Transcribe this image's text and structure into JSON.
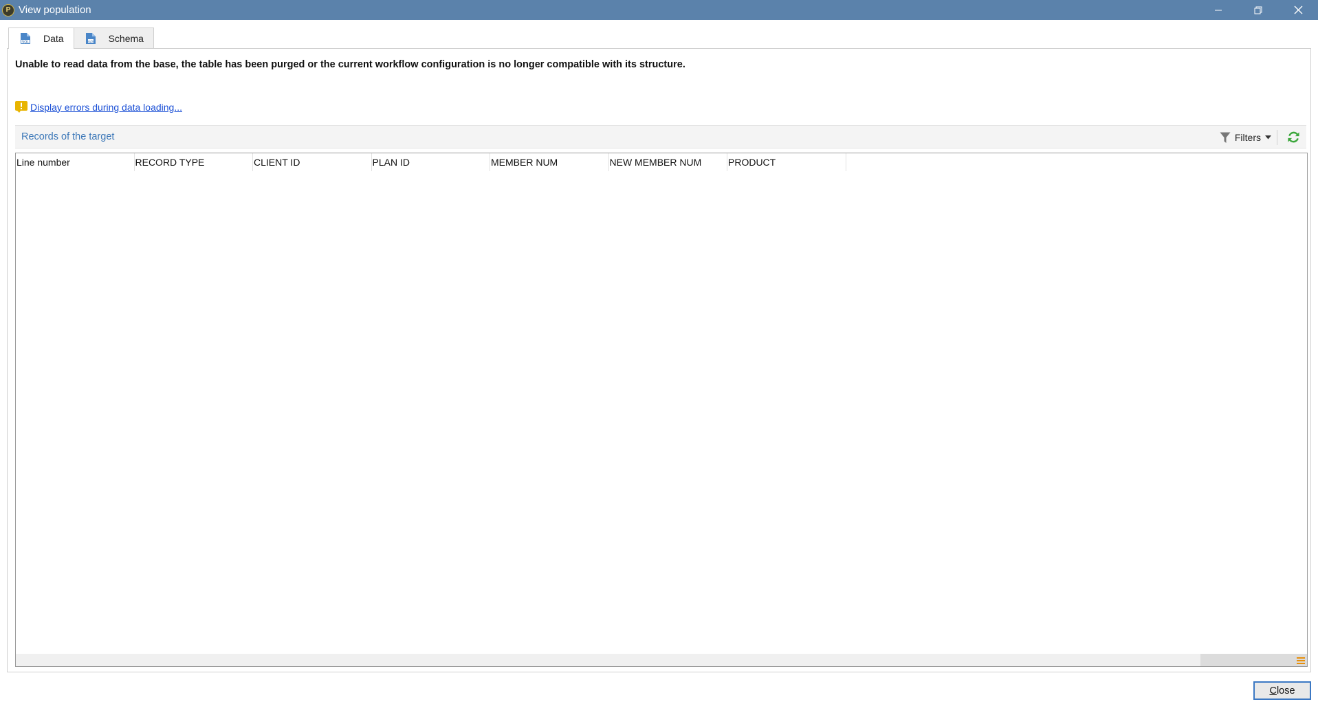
{
  "window": {
    "title": "View population",
    "app_icon": "app-logo-icon",
    "controls": [
      "minimize-icon",
      "restore-icon",
      "close-icon"
    ]
  },
  "tabs": [
    {
      "label": "Data",
      "icon": "sql-file-icon",
      "active": true
    },
    {
      "label": "Schema",
      "icon": "schema-file-icon",
      "active": false
    }
  ],
  "message": {
    "error_text": "Unable to read data from the base, the table has been purged or the current workflow configuration is no longer compatible with its structure.",
    "errors_link": "Display errors during data loading...",
    "warning_icon": "warning-icon"
  },
  "records": {
    "title": "Records of the target",
    "filters_label": "Filters",
    "filter_icon": "filter-funnel-icon",
    "refresh_icon": "refresh-icon"
  },
  "table": {
    "columns": [
      "Line number",
      "RECORD TYPE",
      "CLIENT ID",
      "PLAN ID",
      "MEMBER NUM",
      "NEW MEMBER NUM",
      "PRODUCT"
    ],
    "rows": []
  },
  "footer": {
    "close_label_first": "C",
    "close_label_rest": "lose"
  },
  "colors": {
    "titlebar": "#5b82ab",
    "link": "#1a4fd6",
    "records_title": "#3d78b8",
    "refresh": "#3aa63a",
    "warning": "#e8b400",
    "focus_border": "#3c78c3"
  }
}
